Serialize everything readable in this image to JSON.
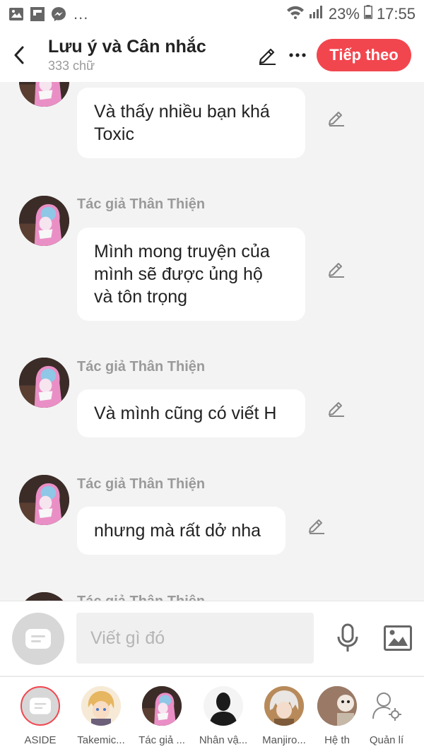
{
  "status_bar": {
    "battery": "23%",
    "time": "17:55",
    "more": "..."
  },
  "header": {
    "title": "Lưu ý và Cân nhắc",
    "subtitle": "333 chữ",
    "next_label": "Tiếp theo"
  },
  "messages": [
    {
      "author": "",
      "lines": [
        "Và thấy nhiều bạn khá",
        "Toxic"
      ]
    },
    {
      "author": "Tác giả Thân Thiện",
      "lines": [
        "Mình mong truyện của",
        "mình sẽ được ủng hộ",
        "và tôn trọng"
      ]
    },
    {
      "author": "Tác giả Thân Thiện",
      "lines": [
        "Và mình cũng có viết H"
      ]
    },
    {
      "author": "Tác giả Thân Thiện",
      "lines": [
        "nhưng mà rất dở nha"
      ]
    },
    {
      "author": "Tác giả Thân Thiện",
      "lines": []
    }
  ],
  "composer": {
    "placeholder": "Viết gì đó"
  },
  "characters": [
    {
      "label": "ASIDE",
      "icon": "aside-icon"
    },
    {
      "label": "Takemic...",
      "icon": "avatar-blonde"
    },
    {
      "label": "Tác giả ...",
      "icon": "avatar-author"
    },
    {
      "label": "Nhân vậ...",
      "icon": "avatar-silhouette"
    },
    {
      "label": "Manjiro...",
      "icon": "avatar-white-hair"
    },
    {
      "label": "Hệ th",
      "icon": "avatar-system"
    },
    {
      "label": "Quản lí",
      "icon": "manage-user-gear-icon"
    }
  ],
  "colors": {
    "accent": "#f2464f",
    "background": "#f3f3f3",
    "muted": "#9a9a9a"
  }
}
